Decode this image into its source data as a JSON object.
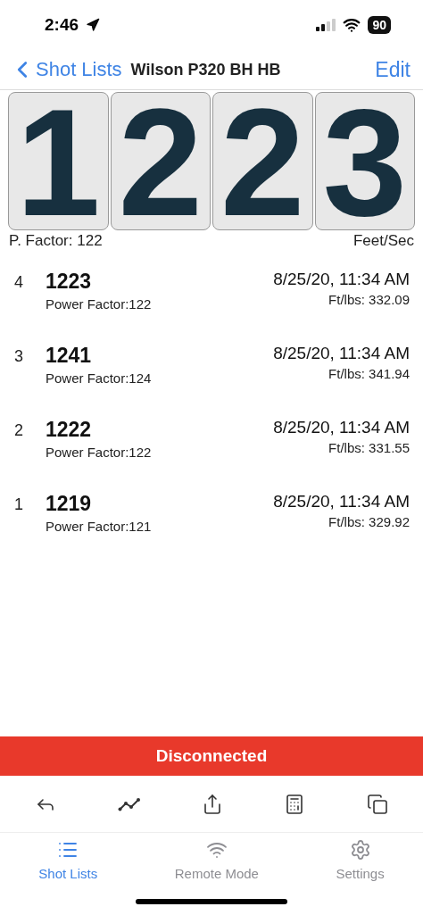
{
  "status_bar": {
    "time": "2:46",
    "battery": "90"
  },
  "nav": {
    "back": "Shot Lists",
    "title": "Wilson P320 BH HB",
    "action": "Edit"
  },
  "display": {
    "digits": [
      "1",
      "2",
      "2",
      "3"
    ],
    "left_label": "P. Factor: 122",
    "right_label": "Feet/Sec"
  },
  "shots": [
    {
      "number": "4",
      "velocity": "1223",
      "power_factor": "Power Factor:122",
      "date": "8/25/20, 11:34 AM",
      "energy": "Ft/lbs: 332.09"
    },
    {
      "number": "3",
      "velocity": "1241",
      "power_factor": "Power Factor:124",
      "date": "8/25/20, 11:34 AM",
      "energy": "Ft/lbs: 341.94"
    },
    {
      "number": "2",
      "velocity": "1222",
      "power_factor": "Power Factor:122",
      "date": "8/25/20, 11:34 AM",
      "energy": "Ft/lbs: 331.55"
    },
    {
      "number": "1",
      "velocity": "1219",
      "power_factor": "Power Factor:121",
      "date": "8/25/20, 11:34 AM",
      "energy": "Ft/lbs: 329.92"
    }
  ],
  "banner": {
    "text": "Disconnected"
  },
  "toolbar": [
    {
      "kind": "reply"
    },
    {
      "kind": "chart"
    },
    {
      "kind": "share"
    },
    {
      "kind": "calculator"
    },
    {
      "kind": "copy"
    }
  ],
  "tabs": [
    {
      "kind": "list",
      "label": "Shot Lists",
      "selected": true
    },
    {
      "kind": "wifi",
      "label": "Remote Mode",
      "selected": false
    },
    {
      "kind": "settings",
      "label": "Settings",
      "selected": false
    }
  ]
}
